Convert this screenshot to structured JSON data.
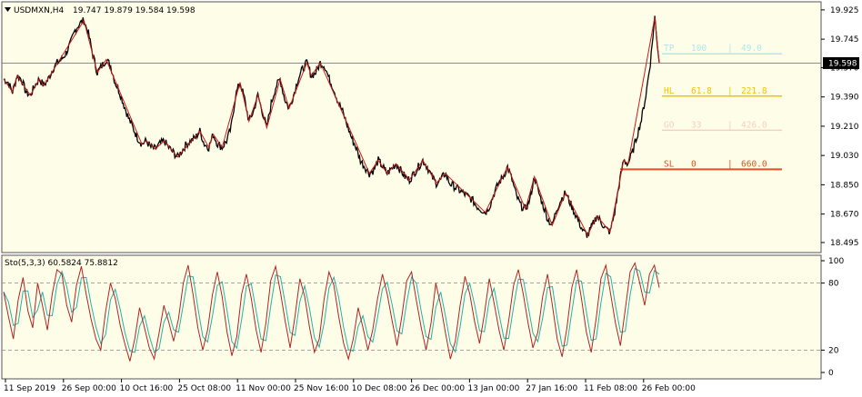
{
  "chart": {
    "symbol": "USDMXN,H4",
    "ohlc": "19.747 19.879 19.584 19.598",
    "current_price": "19.598",
    "menu_icon": "triangle-down-icon"
  },
  "colors": {
    "background": "#fefee8",
    "price_line": "#000000",
    "zigzag": "#cc1a1a",
    "stoch_main": "#b22222",
    "stoch_signal": "#20b2aa",
    "grid": "#8a8a8a"
  },
  "levels": [
    {
      "label": "TP",
      "pct": "100",
      "pips": "49.0",
      "color": "#aee6f2",
      "price": 19.655
    },
    {
      "label": "HL",
      "pct": "61.8",
      "pips": "221.8",
      "color": "#f2c200",
      "price": 19.395
    },
    {
      "label": "GO",
      "pct": "33",
      "pips": "426.0",
      "color": "#f4d0c0",
      "price": 19.185
    },
    {
      "label": "SL",
      "pct": "0",
      "pips": "660.0",
      "color": "#e05020",
      "price": 18.945
    }
  ],
  "indicator": {
    "label": "Sto(5,3,3) 60.5824 75.8812",
    "levels": [
      {
        "value": 80,
        "label": "80"
      },
      {
        "value": 20,
        "label": "20"
      }
    ]
  },
  "chart_data": [
    {
      "type": "line",
      "ylim": [
        18.45,
        19.93
      ],
      "y_ticks": [
        "19.925",
        "19.745",
        "19.570",
        "19.390",
        "19.210",
        "19.030",
        "18.850",
        "18.670",
        "18.495"
      ],
      "x_ticks": [
        "11 Sep 2019",
        "26 Sep 00:00",
        "10 Oct 16:00",
        "25 Oct 08:00",
        "11 Nov 00:00",
        "25 Nov 16:00",
        "10 Dec 08:00",
        "26 Dec 00:00",
        "13 Jan 00:00",
        "27 Jan 16:00",
        "11 Feb 08:00",
        "26 Feb 00:00"
      ],
      "series": [
        {
          "values": [
            19.5,
            19.48,
            19.42,
            19.52,
            19.5,
            19.42,
            19.4,
            19.46,
            19.5,
            19.46,
            19.5,
            19.56,
            19.6,
            19.62,
            19.66,
            19.72,
            19.8,
            19.84,
            19.86,
            19.78,
            19.65,
            19.54,
            19.58,
            19.62,
            19.58,
            19.48,
            19.42,
            19.34,
            19.26,
            19.2,
            19.14,
            19.1,
            19.12,
            19.08,
            19.07,
            19.1,
            19.12,
            19.08,
            19.05,
            19.02,
            19.06,
            19.1,
            19.12,
            19.14,
            19.18,
            19.1,
            19.08,
            19.16,
            19.1,
            19.08,
            19.12,
            19.2,
            19.4,
            19.48,
            19.38,
            19.24,
            19.3,
            19.4,
            19.3,
            19.2,
            19.35,
            19.45,
            19.5,
            19.38,
            19.32,
            19.4,
            19.5,
            19.56,
            19.6,
            19.52,
            19.54,
            19.6,
            19.58,
            19.5,
            19.44,
            19.36,
            19.3,
            19.22,
            19.14,
            19.08,
            19.0,
            18.96,
            18.92,
            18.94,
            19.0,
            18.96,
            18.92,
            18.95,
            18.98,
            18.94,
            18.9,
            18.88,
            18.92,
            18.96,
            19.0,
            18.96,
            18.9,
            18.86,
            18.88,
            18.92,
            18.86,
            18.84,
            18.82,
            18.8,
            18.78,
            18.76,
            18.72,
            18.7,
            18.68,
            18.72,
            18.8,
            18.86,
            18.9,
            18.96,
            18.88,
            18.78,
            18.72,
            18.7,
            18.76,
            18.9,
            18.8,
            18.72,
            18.64,
            18.6,
            18.7,
            18.76,
            18.8,
            18.74,
            18.68,
            18.62,
            18.56,
            18.54,
            18.6,
            18.66,
            18.62,
            18.58,
            18.56,
            18.68,
            18.85,
            19.0,
            18.98,
            19.05,
            19.15,
            19.25,
            19.4,
            19.6,
            19.88,
            19.6
          ]
        },
        {
          "name": "",
          "values": []
        }
      ]
    },
    {
      "type": "line",
      "ylim": [
        0,
        100
      ],
      "y_ticks": [
        "100",
        "80",
        "20",
        "0"
      ],
      "series": [
        {
          "values": [
            72,
            50,
            30,
            65,
            85,
            55,
            40,
            80,
            60,
            38,
            70,
            92,
            88,
            60,
            45,
            78,
            95,
            70,
            48,
            30,
            20,
            55,
            80,
            66,
            42,
            25,
            10,
            30,
            58,
            40,
            22,
            12,
            35,
            60,
            45,
            28,
            48,
            80,
            96,
            70,
            40,
            20,
            38,
            70,
            90,
            68,
            36,
            15,
            32,
            70,
            88,
            66,
            38,
            18,
            44,
            82,
            95,
            72,
            45,
            22,
            50,
            84,
            68,
            40,
            18,
            30,
            66,
            90,
            78,
            50,
            26,
            12,
            30,
            58,
            40,
            20,
            38,
            66,
            88,
            70,
            46,
            24,
            50,
            82,
            90,
            64,
            40,
            20,
            44,
            80,
            60,
            35,
            12,
            28,
            60,
            86,
            70,
            45,
            26,
            52,
            84,
            62,
            38,
            20,
            46,
            78,
            92,
            70,
            44,
            22,
            36,
            68,
            88,
            60,
            30,
            14,
            40,
            76,
            92,
            66,
            36,
            18,
            48,
            84,
            96,
            70,
            44,
            24,
            56,
            90,
            98,
            80,
            60,
            88,
            96,
            76
          ]
        },
        {
          "name": "",
          "values": []
        }
      ]
    }
  ]
}
